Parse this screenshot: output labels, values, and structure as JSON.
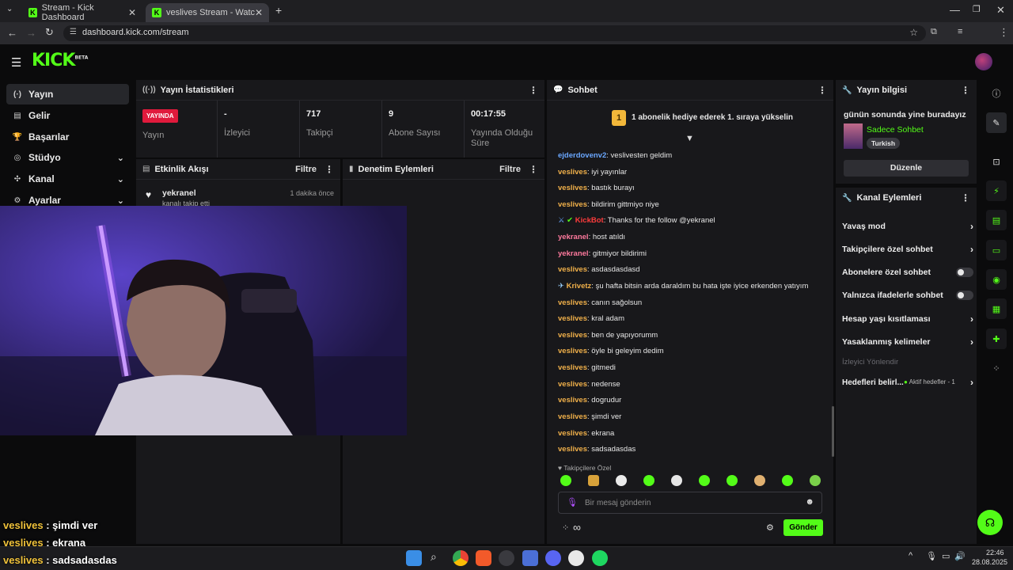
{
  "browser": {
    "tabs": [
      {
        "title": "Stream - Kick Dashboard",
        "active": false
      },
      {
        "title": "veslives Stream - Watch Live on Kick",
        "active": true
      }
    ],
    "url": "dashboard.kick.com/stream"
  },
  "kick": {
    "logo": "KICK",
    "logo_badge": "BETA"
  },
  "nav": {
    "items": [
      {
        "label": "Yayın",
        "icon": "broadcast-icon",
        "glyph": "(·)",
        "active": true
      },
      {
        "label": "Gelir",
        "icon": "revenue-icon",
        "glyph": "▤",
        "active": false
      },
      {
        "label": "Başarılar",
        "icon": "trophy-icon",
        "glyph": "🏆",
        "active": false
      },
      {
        "label": "Stüdyo",
        "icon": "studio-icon",
        "glyph": "◎",
        "active": false,
        "chevron": "⌄"
      },
      {
        "label": "Kanal",
        "icon": "channel-icon",
        "glyph": "✣",
        "active": false,
        "chevron": "⌄"
      },
      {
        "label": "Ayarlar",
        "icon": "settings-icon",
        "glyph": "⚙",
        "active": false,
        "chevron": "⌄"
      }
    ]
  },
  "stats": {
    "title": "Yayın İstatistikleri",
    "live_badge": "YAYINDA",
    "live_label": "Yayın",
    "items": [
      {
        "value": "-",
        "label": "İzleyici"
      },
      {
        "value": "717",
        "label": "Takipçi"
      },
      {
        "value": "9",
        "label": "Abone Sayısı"
      },
      {
        "value": "00:17:55",
        "label": "Yayında Olduğu Süre"
      }
    ]
  },
  "activity": {
    "title": "Etkinlik Akışı",
    "filter": "Filtre",
    "items": [
      {
        "user": "yekranel",
        "time": "1 dakika önce",
        "text": "kanalı takip etti"
      }
    ]
  },
  "moderation": {
    "title": "Denetim Eylemleri",
    "filter": "Filtre"
  },
  "chat": {
    "title": "Sohbet",
    "banner_rank": "1",
    "banner_text": "1 abonelik hediye ederek 1. sıraya yükselin",
    "messages": [
      {
        "user": "ejderdovenv2",
        "color": "blue",
        "text": "veslivesten geldim"
      },
      {
        "user": "veslives",
        "color": "gold",
        "text": "iyi yayınlar"
      },
      {
        "user": "veslives",
        "color": "gold",
        "text": "bastık burayı"
      },
      {
        "user": "veslives",
        "color": "gold",
        "text": "bildirim gittmiyo niye"
      },
      {
        "user": "KickBot",
        "color": "red",
        "text": "Thanks for the follow @yekranel"
      },
      {
        "user": "yekranel",
        "color": "pink",
        "text": "host atıldı"
      },
      {
        "user": "yekranel",
        "color": "pink",
        "text": "gitmiyor bildirimi"
      },
      {
        "user": "veslives",
        "color": "gold",
        "text": "asdasdasdasd"
      },
      {
        "user": "Krivetz",
        "color": "gold",
        "text": "şu hafta bitsin arda daraldım bu hata işte iyice erkenden yatıyım"
      },
      {
        "user": "veslives",
        "color": "gold",
        "text": "canın sağolsun"
      },
      {
        "user": "veslives",
        "color": "gold",
        "text": "kral adam"
      },
      {
        "user": "veslives",
        "color": "gold",
        "text": "ben de yapıyorumm"
      },
      {
        "user": "veslives",
        "color": "gold",
        "text": "öyle bi geleyim dedim"
      },
      {
        "user": "veslives",
        "color": "gold",
        "text": "gitmedi"
      },
      {
        "user": "veslives",
        "color": "gold",
        "text": "nedense"
      },
      {
        "user": "veslives",
        "color": "gold",
        "text": "dogrudur"
      },
      {
        "user": "veslives",
        "color": "gold",
        "text": "şimdi ver"
      },
      {
        "user": "veslives",
        "color": "gold",
        "text": "ekrana"
      },
      {
        "user": "veslives",
        "color": "gold",
        "text": "sadsadasdas"
      }
    ],
    "followers_only": "Takipçilere Özel",
    "input_placeholder": "Bir mesaj gönderin",
    "send_label": "Gönder",
    "infinity": "∞"
  },
  "stream_info": {
    "title": "Yayın bilgisi",
    "stream_title": "günün sonunda yine buradayız",
    "category": "Sadece Sohbet",
    "language": "Turkish",
    "edit_label": "Düzenle"
  },
  "channel_actions": {
    "title": "Kanal Eylemleri",
    "items": [
      {
        "label": "Yavaş mod",
        "type": "arrow"
      },
      {
        "label": "Takipçilere özel sohbet",
        "type": "arrow"
      },
      {
        "label": "Abonelere özel sohbet",
        "type": "toggle"
      },
      {
        "label": "Yalnızca ifadelerle sohbet",
        "type": "toggle"
      },
      {
        "label": "Hesap yaşı kısıtlaması",
        "type": "arrow"
      },
      {
        "label": "Yasaklanmış kelimeler",
        "type": "arrow"
      }
    ],
    "redirect_label": "İzleyici Yönlendir",
    "goals_label": "Hedefleri belirl...",
    "goals_status": "Aktif hedefler - 1"
  },
  "overlay_chat": [
    {
      "user": "veslives",
      "text": "şimdi ver"
    },
    {
      "user": "veslives",
      "text": "ekrana"
    },
    {
      "user": "veslives",
      "text": "sadsadasdas"
    }
  ],
  "taskbar": {
    "time": "22:46",
    "date": "28.08.2025"
  },
  "colors": {
    "accent": "#53fc18",
    "live": "#e01a3c",
    "panel": "#18181b"
  }
}
